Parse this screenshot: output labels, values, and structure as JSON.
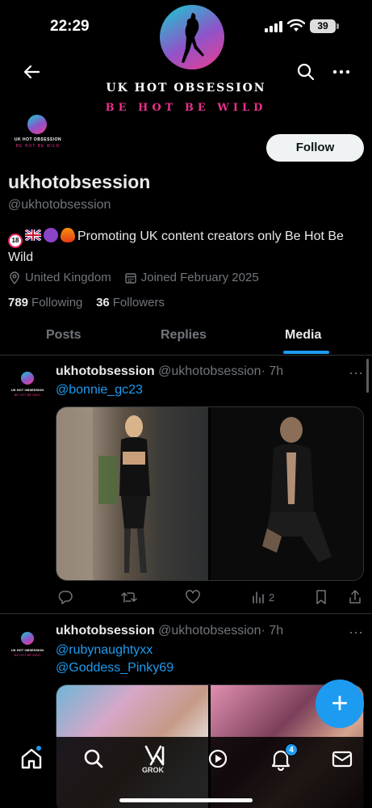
{
  "status": {
    "time": "22:29",
    "battery": "39"
  },
  "banner": {
    "title": "UK HOT OBSESSION",
    "subtitle": "BE HOT BE WILD"
  },
  "avatar": {
    "title": "UK HOT OBSESSION",
    "subtitle": "BE HOT BE WILD"
  },
  "profile": {
    "follow_label": "Follow",
    "display_name": "ukhotobsession",
    "handle": "@ukhotobsession",
    "bio": "Promoting UK content creators only Be Hot Be Wild",
    "location": "United Kingdom",
    "joined": "Joined February 2025",
    "following_count": "789",
    "following_label": "Following",
    "followers_count": "36",
    "followers_label": "Followers"
  },
  "tabs": [
    {
      "label": "Posts"
    },
    {
      "label": "Replies"
    },
    {
      "label": "Media",
      "active": true
    }
  ],
  "posts": [
    {
      "name": "ukhotobsession",
      "handle": "@ukhotobsession",
      "time": "· 7h",
      "mentions": [
        "@bonnie_gc23"
      ],
      "views": "2"
    },
    {
      "name": "ukhotobsession",
      "handle": "@ukhotobsession",
      "time": "· 7h",
      "mentions": [
        "@rubynaughtyxx",
        "@Goddess_Pinky69"
      ]
    }
  ],
  "nav": {
    "grok_label": "GROK",
    "notifications_badge": "4"
  },
  "colors": {
    "accent": "#1d9bf0",
    "brand_pink": "#e8308a",
    "muted": "#71767b"
  }
}
